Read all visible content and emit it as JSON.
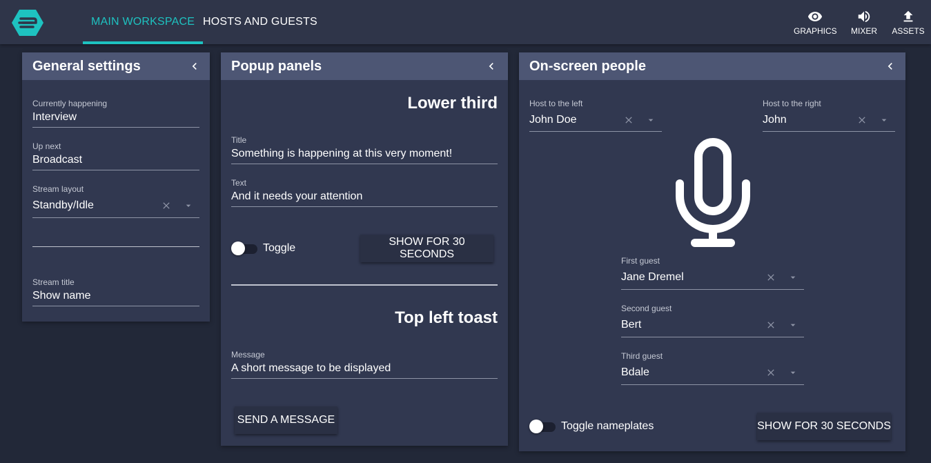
{
  "nav": {
    "tabs": [
      {
        "label": "MAIN WORKSPACE",
        "active": true
      },
      {
        "label": "HOSTS AND GUESTS",
        "active": false
      }
    ],
    "actions": [
      {
        "label": "GRAPHICS",
        "icon": "eye-icon"
      },
      {
        "label": "MIXER",
        "icon": "volume-icon"
      },
      {
        "label": "ASSETS",
        "icon": "upload-icon"
      }
    ]
  },
  "colors": {
    "accent": "#1ec2c0",
    "background": "#222838",
    "panel": "#313850",
    "panel_header": "#4d5674"
  },
  "general": {
    "title": "General settings",
    "currently_happening": {
      "label": "Currently happening",
      "value": "Interview"
    },
    "up_next": {
      "label": "Up next",
      "value": "Broadcast"
    },
    "stream_layout": {
      "label": "Stream layout",
      "value": "Standby/Idle"
    },
    "stream_title": {
      "label": "Stream title",
      "value": "Show name"
    }
  },
  "popup": {
    "title": "Popup panels",
    "lower_third": {
      "heading": "Lower third",
      "title_field": {
        "label": "Title",
        "value": "Something is happening at this very moment!"
      },
      "text_field": {
        "label": "Text",
        "value": "And it needs your attention"
      },
      "toggle_label": "Toggle",
      "toggle_on": false,
      "show_button": "SHOW FOR 30 SECONDS"
    },
    "toast": {
      "heading": "Top left toast",
      "message_field": {
        "label": "Message",
        "value": "A short message to be displayed"
      },
      "send_button": "SEND A MESSAGE"
    }
  },
  "people": {
    "title": "On-screen people",
    "host_left": {
      "label": "Host to the left",
      "value": "John Doe"
    },
    "host_right": {
      "label": "Host to the right",
      "value": "John"
    },
    "center_icon": "microphone-icon",
    "guests": [
      {
        "label": "First guest",
        "value": "Jane Dremel"
      },
      {
        "label": "Second guest",
        "value": "Bert"
      },
      {
        "label": "Third guest",
        "value": "Bdale"
      }
    ],
    "toggle_label": "Toggle nameplates",
    "toggle_on": false,
    "show_button": "SHOW FOR 30 SECONDS"
  }
}
